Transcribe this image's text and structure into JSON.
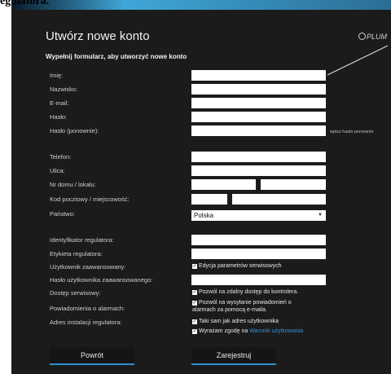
{
  "caption": "egulatora.",
  "header": {
    "title": "Utwórz nowe konto",
    "subtitle": "Wypełnij formularz, aby utworzyć nowe konto",
    "logo": "PLUM"
  },
  "fields": {
    "imie": {
      "label": "Imię:",
      "value": ""
    },
    "nazwisko": {
      "label": "Nazwisko:",
      "value": ""
    },
    "email": {
      "label": "E-mail:",
      "value": ""
    },
    "haslo": {
      "label": "Hasło:",
      "value": ""
    },
    "haslo2": {
      "label": "Hasło (ponownie):",
      "value": "",
      "hint": "wpisz hasło ponownie"
    },
    "telefon": {
      "label": "Telefon:",
      "value": ""
    },
    "ulica": {
      "label": "Ulica:",
      "value": ""
    },
    "nr_domu": {
      "label": "Nr domu / lokalu:",
      "value": ""
    },
    "kod": {
      "label": "Kod pocztowy / miejscowość:",
      "value": ""
    },
    "panstwo": {
      "label": "Państwo:",
      "value": "Polska"
    },
    "id_regulatora": {
      "label": "Identyfikator regulatora:",
      "value": ""
    },
    "etykieta": {
      "label": "Etykieta regulatora:",
      "value": ""
    },
    "uzytkownik_zaaw": {
      "label": "Użytkownik zaawansowany:",
      "checkbox": "Edycja parametrów serwisowych"
    },
    "haslo_zaaw": {
      "label": "Hasło użytkownika zaawansowanego:",
      "value": ""
    },
    "dostep": {
      "label": "Dostęp serwisowy:",
      "checkbox": "Pozwól na zdalny dostęp do kontrolera."
    },
    "powiadomienia": {
      "label": "Powiadomienia o alarmach:",
      "checkbox_line1": "Pozwól na wysyłanie powiadomień o",
      "checkbox_line2": "alarmach za pomocą e-maila."
    },
    "adres_instalacji": {
      "label": "Adres instalacji regulatora:",
      "checkbox": "Taki sam jak adres użytkownika"
    },
    "zgoda": {
      "checkbox": "Wyrażam zgodę na",
      "link": "Warunki użytkowania"
    }
  },
  "buttons": {
    "back": "Powrót",
    "register": "Zarejestruj"
  }
}
